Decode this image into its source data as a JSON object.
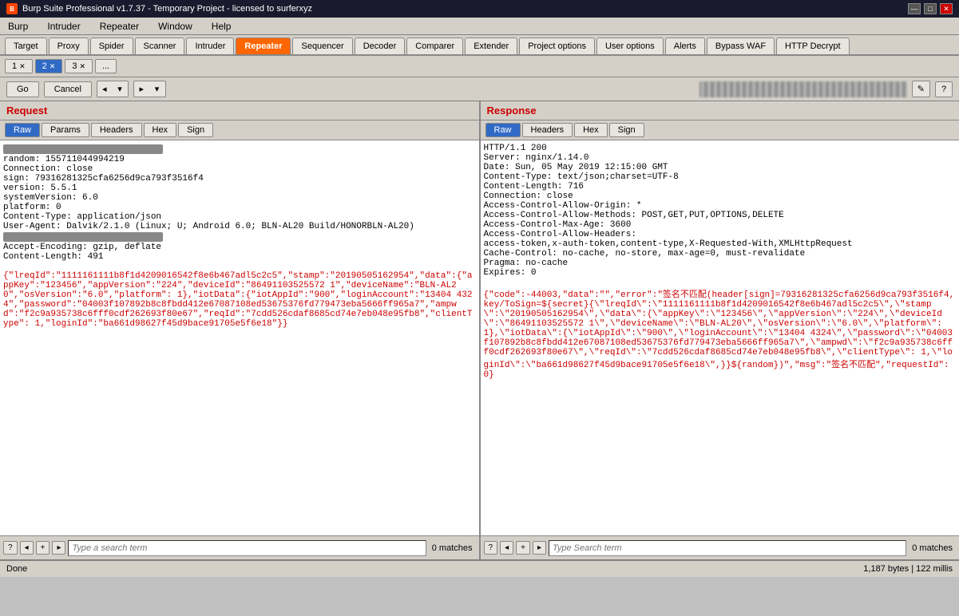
{
  "titleBar": {
    "title": "Burp Suite Professional v1.7.37 - Temporary Project - licensed to surferxyz",
    "icon": "B",
    "controls": [
      "—",
      "□",
      "✕"
    ]
  },
  "menuBar": {
    "items": [
      "Burp",
      "Intruder",
      "Repeater",
      "Window",
      "Help"
    ]
  },
  "navTabs": {
    "items": [
      "Target",
      "Proxy",
      "Spider",
      "Scanner",
      "Intruder",
      "Repeater",
      "Sequencer",
      "Decoder",
      "Comparer",
      "Extender",
      "Project options",
      "User options",
      "Alerts",
      "Bypass WAF",
      "HTTP Decrypt"
    ],
    "active": "Repeater"
  },
  "subTabs": {
    "items": [
      "1",
      "2",
      "3",
      "..."
    ],
    "active": "2"
  },
  "toolbar": {
    "go": "Go",
    "cancel": "Cancel",
    "edit_icon": "✎",
    "help_icon": "?"
  },
  "request": {
    "title": "Request",
    "tabs": [
      "Raw",
      "Params",
      "Headers",
      "Hex",
      "Sign"
    ],
    "activeTab": "Raw",
    "lines": [
      {
        "type": "blurred",
        "text": "POST /api/login HTTP/1.1"
      },
      {
        "type": "normal",
        "text": "random: 155711044994219"
      },
      {
        "type": "normal",
        "text": "Connection: close"
      },
      {
        "type": "normal",
        "text": "sign: 79316281325cfa6256d9ca793f3516f4"
      },
      {
        "type": "normal",
        "text": "version: 5.5.1"
      },
      {
        "type": "normal",
        "text": "systemVersion: 6.0"
      },
      {
        "type": "normal",
        "text": "platform: 0"
      },
      {
        "type": "normal",
        "text": "Content-Type: application/json"
      },
      {
        "type": "normal",
        "text": "User-Agent: Dalvik/2.1.0 (Linux; U; Android 6.0; BLN-AL20 Build/HONORBLN-AL20)"
      },
      {
        "type": "blurred",
        "text": "Host: blurred"
      },
      {
        "type": "normal",
        "text": "Accept-Encoding: gzip, deflate"
      },
      {
        "type": "normal",
        "text": "Content-Length: 491"
      },
      {
        "type": "empty",
        "text": ""
      },
      {
        "type": "red",
        "text": "{\"lreqId\":\"1111161111b8f1d4209016542f8e6b467adl5c2c5\",\"stamp\":\"20190505162954\",\"data\":{\"appKey\":\"123456\",\"appVersion\":\"224\",\"deviceId\":\"86491103525572 1\",\"deviceName\":\"BLN-AL20\",\"osVersion\":\"6.0\",\"platform\": 1},\"iotData\":{\"iotAppId\":\"900\",\"loginAccount\":\"13404 4324\",\"password\":\"04003f107892b8c8fbdd412e67087108ed53675376fd779473eba5666ff965a7\",\"ampwd\":\"f2c9a935738c6fff0cdf262693f80e67\",\"reqId\":\"7cdd526cdaf8685cd74e7eb048e95fb8\",\"clientType\": 1,\"loginId\":\"ba661d98627f45d9bace91705e5f6e18\"}}"
      }
    ],
    "searchPlaceholder": "Type a search term",
    "matches": "0 matches"
  },
  "response": {
    "title": "Response",
    "tabs": [
      "Raw",
      "Headers",
      "Hex",
      "Sign"
    ],
    "activeTab": "Raw",
    "lines": [
      {
        "type": "normal",
        "text": "HTTP/1.1 200"
      },
      {
        "type": "normal",
        "text": "Server: nginx/1.14.0"
      },
      {
        "type": "normal",
        "text": "Date: Sun, 05 May 2019 12:15:00 GMT"
      },
      {
        "type": "normal",
        "text": "Content-Type: text/json;charset=UTF-8"
      },
      {
        "type": "normal",
        "text": "Content-Length: 716"
      },
      {
        "type": "normal",
        "text": "Connection: close"
      },
      {
        "type": "normal",
        "text": "Access-Control-Allow-Origin: *"
      },
      {
        "type": "normal",
        "text": "Access-Control-Allow-Methods: POST,GET,PUT,OPTIONS,DELETE"
      },
      {
        "type": "normal",
        "text": "Access-Control-Max-Age: 3600"
      },
      {
        "type": "normal",
        "text": "Access-Control-Allow-Headers:"
      },
      {
        "type": "normal",
        "text": "access-token,x-auth-token,content-type,X-Requested-With,XMLHttpRequest"
      },
      {
        "type": "normal",
        "text": "Cache-Control: no-cache, no-store, max-age=0, must-revalidate"
      },
      {
        "type": "normal",
        "text": "Pragma: no-cache"
      },
      {
        "type": "normal",
        "text": "Expires: 0"
      },
      {
        "type": "empty",
        "text": ""
      },
      {
        "type": "red",
        "text": "{\"code\":-44003,\"data\":\"\",\"error\":\"签名不匹配(header[sign]=79316281325cfa6256d9ca793f3516f4, key/ToSign=${secret}{\\\"lreqId\\\":\\\"1111161111b8f1d4209016542f8e6b467adl5c2c5\\\",\\\"stamp\\\":\\\"20190505162954\\\",\\\"data\\\":{\\\"appKey\\\":\\\"123456\\\",\\\"appVersion\\\":\\\"224\\\",\\\"deviceId\\\":\\\"86491103525572 1\\\",\\\"deviceName\\\":\\\"BLN-AL20\\\",\\\"osVersion\\\":\\\"6.0\\\",\\\"platform\\\": 1},\\\"iotData\\\":{\\\"iotAppId\\\":\\\"900\\\",\\\"loginAccount\\\":\\\"13404 4324\\\",\\\"password\\\":\\\"04003f107892b8c8fbdd412e67087108ed53675376fd779473eba5666ff965a7\\\",\\\"ampwd\\\":\\\"f2c9a935738c6fff0cdf262693f80e67\\\",\\\"reqId\\\":\\\"7cdd526cdaf8685cd74e7eb048e95fb8\\\",\\\"clientType\\\": 1,\\\"loginId\\\":\\\"ba661d98627f45d9bace91705e5f6e18\\\",}}${random})\",\"msg\":\"签名不匹配\",\"requestId\": 0}"
      }
    ],
    "searchPlaceholder": "Type Search term",
    "matches": "0 matches"
  },
  "statusBar": {
    "left": "Done",
    "right": "1,187 bytes | 122 millis"
  }
}
